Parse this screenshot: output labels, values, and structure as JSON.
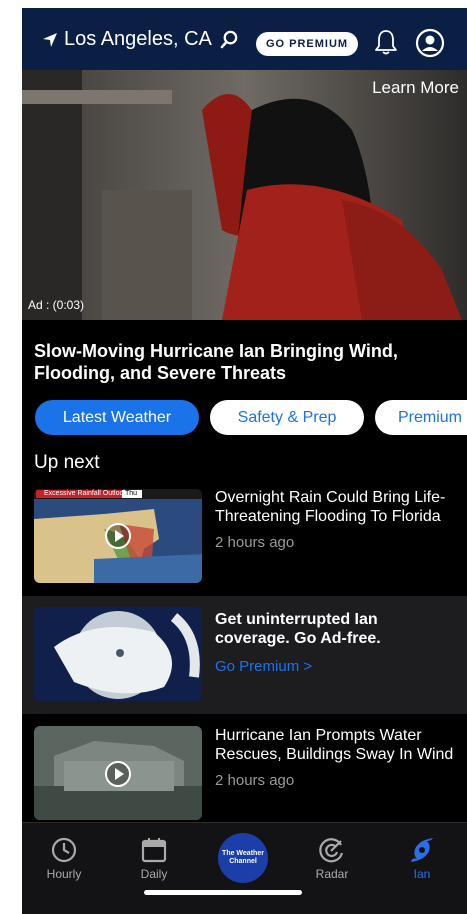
{
  "header": {
    "location": "Los Angeles, CA",
    "premium_label": "GO PREMIUM",
    "icons": [
      "location-arrow-icon",
      "search-icon",
      "bell-icon",
      "profile-icon"
    ]
  },
  "video": {
    "learn_more": "Learn More",
    "ad_timer": "Ad : (0:03)"
  },
  "headline": "Slow-Moving Hurricane Ian Bringing Wind, Flooding, and Severe Threats",
  "chips": [
    {
      "label": "Latest Weather",
      "active": true
    },
    {
      "label": "Safety & Prep",
      "active": false
    },
    {
      "label": "Premium",
      "active": false
    }
  ],
  "up_next": {
    "heading": "Up next",
    "items": [
      {
        "title": "Overnight Rain Could Bring Life-Threatening Flooding To Florida",
        "time": "2 hours ago",
        "thumb_caption": "Excessive Rainfall Outlook",
        "thumb_day": "Thu"
      },
      {
        "title": "Get uninterrupted Ian coverage. Go Ad-free.",
        "link": "Go Premium >"
      },
      {
        "title": "Hurricane Ian Prompts Water Rescues, Buildings Sway In Wind",
        "time": "2 hours ago"
      }
    ]
  },
  "bottom_nav": {
    "items": [
      {
        "label": "Hourly",
        "icon": "clock-icon"
      },
      {
        "label": "Daily",
        "icon": "calendar-icon"
      },
      {
        "label": "The Weather Channel",
        "icon": "twc-logo"
      },
      {
        "label": "Radar",
        "icon": "radar-icon"
      },
      {
        "label": "Ian",
        "icon": "hurricane-icon",
        "active": true
      }
    ]
  },
  "colors": {
    "header_bg": "#0b1f45",
    "accent": "#1a73e8",
    "background": "#000000"
  }
}
